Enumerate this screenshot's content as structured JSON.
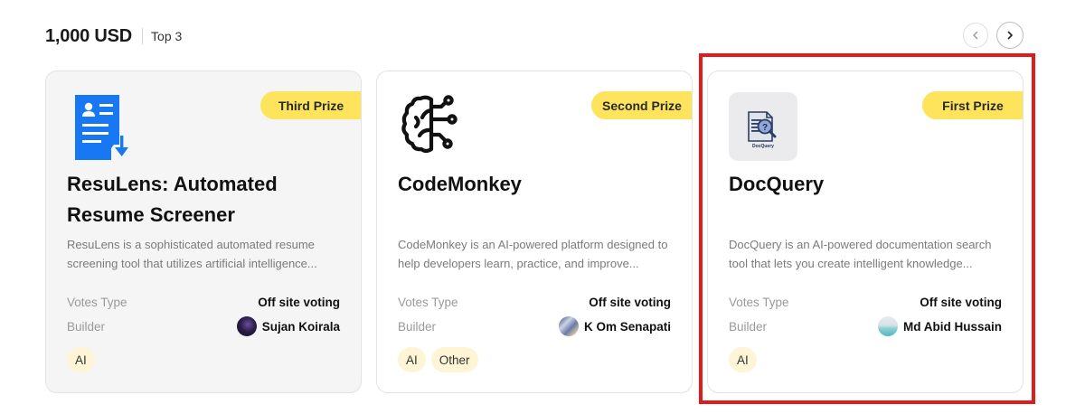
{
  "header": {
    "amount": "1,000 USD",
    "top_label": "Top 3"
  },
  "nav": {
    "prev_icon": "chevron-left-icon",
    "next_icon": "chevron-right-icon"
  },
  "cards": [
    {
      "badge": "Third Prize",
      "logo_icon": "resume-document-icon",
      "title": "ResuLens: Automated Resume Screener",
      "description": "ResuLens is a sophisticated automated resume screening tool that utilizes artificial intelligence...",
      "votes_label": "Votes Type",
      "votes_value": "Off site voting",
      "builder_label": "Builder",
      "builder_name": "Sujan Koirala",
      "tags": [
        "AI"
      ]
    },
    {
      "badge": "Second Prize",
      "logo_icon": "brain-circuit-icon",
      "title": "CodeMonkey",
      "description": "CodeMonkey is an AI-powered platform designed to help developers learn, practice, and improve...",
      "votes_label": "Votes Type",
      "votes_value": "Off site voting",
      "builder_label": "Builder",
      "builder_name": "K Om Senapati",
      "tags": [
        "AI",
        "Other"
      ]
    },
    {
      "badge": "First Prize",
      "logo_icon": "docquery-logo-icon",
      "logo_text": "DocQuery",
      "title": "DocQuery",
      "description": "DocQuery is an AI-powered documentation search tool that lets you create intelligent knowledge...",
      "votes_label": "Votes Type",
      "votes_value": "Off site voting",
      "builder_label": "Builder",
      "builder_name": "Md Abid Hussain",
      "tags": [
        "AI"
      ]
    }
  ],
  "colors": {
    "badge": "#fde45c",
    "tag_bg": "#fdf5d6",
    "highlight": "#e01b1b",
    "accent_blue": "#1877f2"
  }
}
